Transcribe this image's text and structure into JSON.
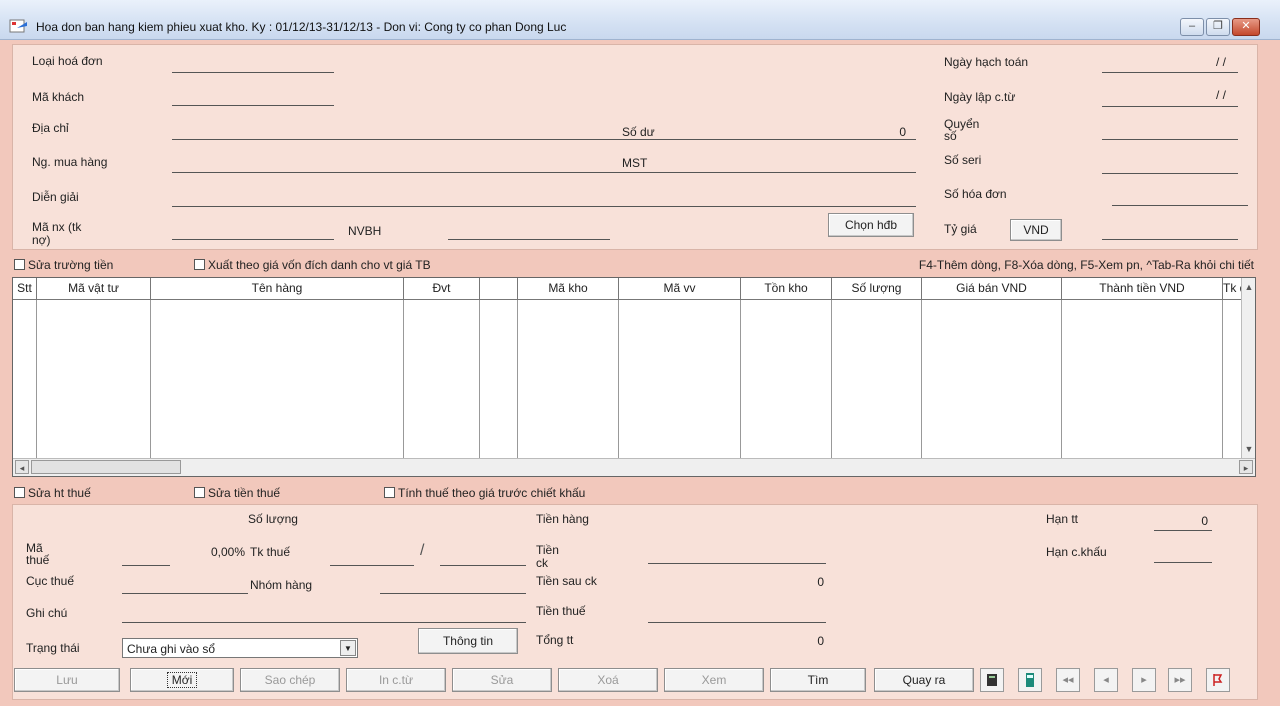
{
  "window": {
    "title": "Hoa don ban hang kiem phieu xuat kho. Ky : 01/12/13-31/12/13 - Don vi: Cong ty co phan Dong Luc",
    "minimize": "–",
    "restore": "❐",
    "close": "✕"
  },
  "header": {
    "loai_hoa_don": "Loại hoá đơn",
    "ma_khach": "Mã khách",
    "dia_chi": "Địa chỉ",
    "so_du": "Số dư",
    "so_du_value": "0",
    "ng_mua_hang": "Ng. mua hàng",
    "mst": "MST",
    "dien_giai": "Diễn giải",
    "ma_nx": "Mã nx (tk nợ)",
    "nvbh": "NVBH",
    "chon_hdb": "Chọn hđb",
    "ngay_hach_toan": "Ngày hạch toán",
    "ngay_hach_toan_value": "/ /",
    "ngay_lap_ctu": "Ngày lập c.từ",
    "ngay_lap_ctu_value": "/ /",
    "quyen_so": "Quyển số",
    "so_seri": "Số seri",
    "so_hoa_don": "Số hóa đơn",
    "ty_gia": "Tỷ giá",
    "currency": "VND"
  },
  "options": {
    "sua_truong_tien": "Sửa trường tiền",
    "xuat_theo_gia_von": "Xuất theo giá vốn đích danh cho vt giá TB",
    "shortcuts": "F4-Thêm dòng, F8-Xóa dòng, F5-Xem pn, ^Tab-Ra khỏi chi tiết"
  },
  "grid": {
    "columns": [
      "Stt",
      "Mã vật tư",
      "Tên hàng",
      "Đvt",
      "",
      "Mã kho",
      "Mã vv",
      "Tồn kho",
      "Số lượng",
      "Giá bán VND",
      "Thành tiền VND",
      "Tk d"
    ]
  },
  "tax_options": {
    "sua_ht_thue": "Sửa ht thuế",
    "sua_tien_thue": "Sửa tiền thuế",
    "tinh_thue": "Tính thuế theo giá trước chiết khấu"
  },
  "footer": {
    "so_luong": "Số lượng",
    "ma_thue": "Mã thuế",
    "tax_rate": "0,00%",
    "tk_thue": "Tk thuế",
    "cuc_thue": "Cục thuế",
    "nhom_hang": "Nhóm hàng",
    "ghi_chu": "Ghi chú",
    "trang_thai": "Trạng thái",
    "trang_thai_value": "Chưa ghi vào sổ",
    "thong_tin": "Thông tin",
    "tien_hang": "Tiền hàng",
    "tien_ck": "Tiền ck",
    "tien_sau_ck": "Tiền sau ck",
    "tien_sau_ck_value": "0",
    "tien_thue": "Tiền thuế",
    "tong_tt": "Tổng tt",
    "tong_tt_value": "0",
    "han_tt": "Hạn tt",
    "han_tt_value": "0",
    "han_ckhau": "Hạn c.khấu"
  },
  "toolbar": {
    "luu": "Lưu",
    "moi": "Mới",
    "sao_chep": "Sao chép",
    "in_ctu": "In c.từ",
    "sua": "Sửa",
    "xoa": "Xoá",
    "xem": "Xem",
    "tim": "Tìm",
    "quay_ra": "Quay ra",
    "first": "◂◂",
    "prev": "◂",
    "next": "▸",
    "last": "▸▸"
  }
}
